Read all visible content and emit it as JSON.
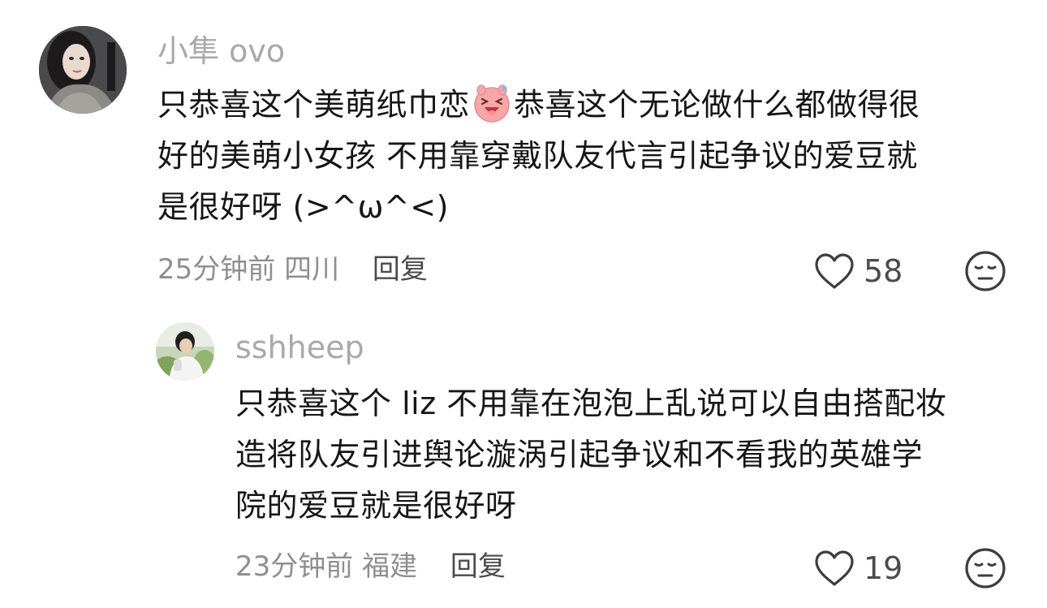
{
  "comments": [
    {
      "username": "小隼 ovo",
      "avatar_icon": "user-avatar-woman",
      "body_lines": [
        {
          "before": "只恭喜这个美萌纸巾恋",
          "emoji": "laughing-pig-sticker",
          "after": "恭喜这个无论做什么都做得很"
        },
        {
          "text": "好的美萌小女孩 不用靠穿戴队友代言引起争议的爱豆就"
        },
        {
          "text": "是很好呀 (>^ω^<)"
        }
      ],
      "time": "25分钟前",
      "location": "四川",
      "reply_label": "回复",
      "likes": "58",
      "like_icon": "heart-outline-icon",
      "dislike_icon": "expressionless-face-icon"
    }
  ],
  "replies": [
    {
      "username": "sshheep",
      "avatar_icon": "user-avatar-person",
      "body_lines": [
        "只恭喜这个 liz 不用靠在泡泡上乱说可以自由搭配妆",
        "造将队友引进舆论漩涡引起争议和不看我的英雄学",
        "院的爱豆就是很好呀"
      ],
      "time": "23分钟前",
      "location": "福建",
      "reply_label": "回复",
      "likes": "19",
      "like_icon": "heart-outline-icon",
      "dislike_icon": "expressionless-face-icon"
    }
  ],
  "colors": {
    "username": "#a9a9a9",
    "body_text": "#161616",
    "meta_text": "#8f8f8f",
    "reply_label": "#4a4a4a",
    "icon_stroke": "#3d3d3d",
    "sticker_pink": "#f6a8a8"
  }
}
